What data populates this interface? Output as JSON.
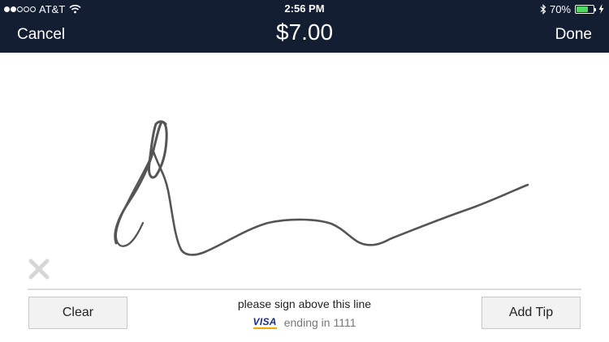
{
  "status_bar": {
    "carrier": "AT&T",
    "time": "2:56 PM",
    "battery_percent": "70%",
    "battery_level": 0.7,
    "signal_bars_filled": 2,
    "signal_bars_total": 5,
    "icons": [
      "wifi-icon",
      "bluetooth-icon",
      "battery-icon",
      "charging-bolt-icon"
    ]
  },
  "nav": {
    "cancel_label": "Cancel",
    "amount": "$7.00",
    "done_label": "Done"
  },
  "signature": {
    "instruction": "please sign above this line",
    "card_brand": "VISA",
    "card_ending": "ending in 1111"
  },
  "buttons": {
    "clear_label": "Clear",
    "tip_label": "Add Tip"
  },
  "colors": {
    "nav_background": "#141e32",
    "stroke": "#555555",
    "battery_fill": "#4cd964",
    "visa_blue": "#1a2c8c"
  }
}
